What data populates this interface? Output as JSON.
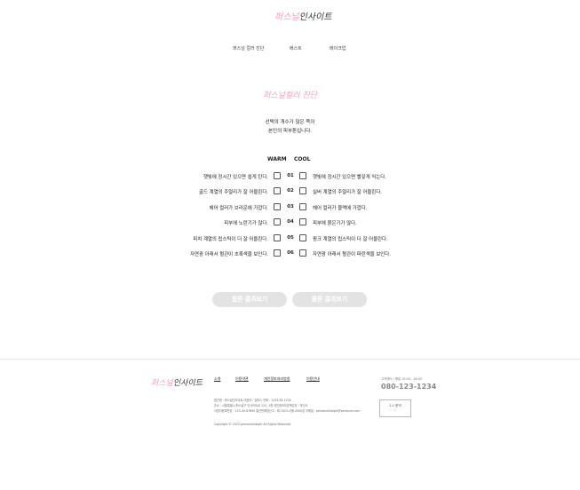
{
  "header": {
    "logo_pink": "퍼스널",
    "logo_dark": "인사이트"
  },
  "nav": {
    "items": [
      "퍼스널 컬러 진단",
      "베스트",
      "메이크업"
    ]
  },
  "diagnosis": {
    "title": "퍼스널컬러 진단",
    "desc_line1": "선택의 개수가 많은 쪽이",
    "desc_line2": "본인의 피부톤입니다.",
    "warm_label": "WARM",
    "cool_label": "COOL",
    "rows": [
      {
        "num": "01",
        "warm": "햇빛에 장시간 있으면 쉽게 탄다.",
        "cool": "햇빛에 장시간 있으면 빨갛게 익는다."
      },
      {
        "num": "02",
        "warm": "골드 계열의 주얼리가 잘 어울린다.",
        "cool": "실버 계열의 주얼리가 잘 어울린다."
      },
      {
        "num": "03",
        "warm": "헤어 컬러가 브라운에 가깝다.",
        "cool": "헤어 컬러가 블랙에 가깝다."
      },
      {
        "num": "04",
        "warm": "피부에 노란기가 많다.",
        "cool": "피부에 붉은기가 많다."
      },
      {
        "num": "05",
        "warm": "피치 계열의 립스틱이 더 잘 어울린다.",
        "cool": "핑크 계열의 립스틱이 더 잘 어울린다."
      },
      {
        "num": "06",
        "warm": "자연광 아래서 혈관이 초록색을 보인다.",
        "cool": "자연광 아래서 혈관이 파란색을 보인다."
      }
    ],
    "warm_button": "웜톤 결과보기",
    "cool_button": "쿨톤 결과보기"
  },
  "footer": {
    "logo_pink": "퍼스널",
    "logo_dark": "인사이트",
    "nav": [
      "소개",
      "이용약관",
      "개인정보처리방침",
      "이용안내"
    ],
    "info_line1": "법인명 : 퍼스널인사이트     대표자 : 김퍼스     전화 : 1234-56-1234",
    "info_line2": "주소 : 서울특별시 퍼스널구 인사이트로 123, 1층     개인정보보호책임자 : 박인사",
    "info_line3": "사업자등록번호 : 123-45-67890     통신판매업신고 : 제 2023-서울-0000호     이메일 : personalinsight@personal.com",
    "copyright": "Copyright © 2023 personalinsight All Rights Reserved",
    "cs_label": "고객센터 / 평일 10:00 - 18:00",
    "cs_phone": "080-123-1234",
    "cs_box_line1": "1:1 문의",
    "cs_box_line2": "›"
  }
}
